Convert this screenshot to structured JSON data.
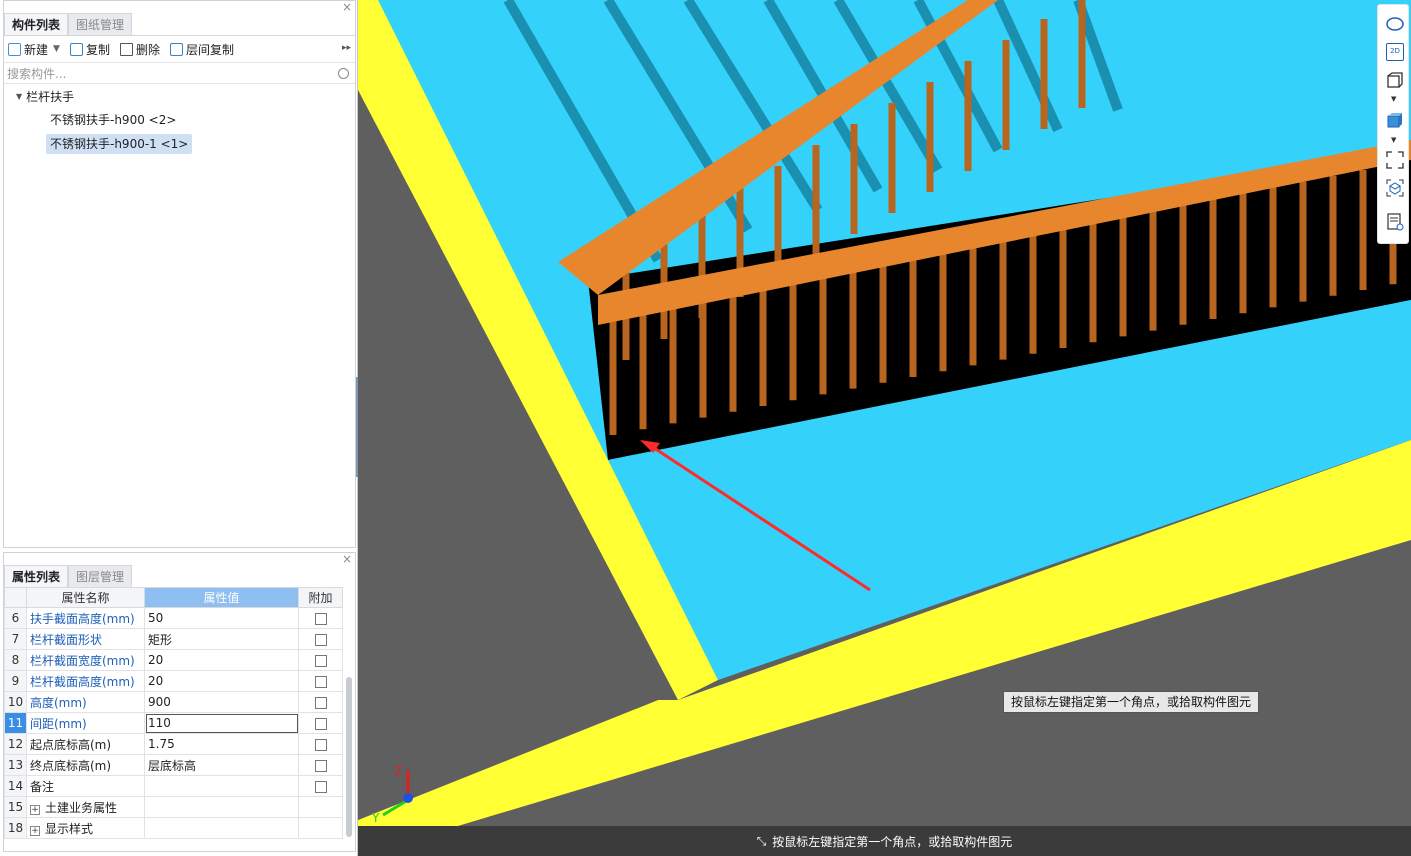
{
  "component_panel": {
    "tabs": [
      "构件列表",
      "图纸管理"
    ],
    "toolbar": {
      "new": "新建",
      "copy": "复制",
      "delete": "删除",
      "floor_copy": "层间复制"
    },
    "search_placeholder": "搜索构件...",
    "tree": {
      "root": "栏杆扶手",
      "items": [
        {
          "label": "不锈钢扶手-h900 <2>",
          "selected": false
        },
        {
          "label": "不锈钢扶手-h900-1 <1>",
          "selected": true
        }
      ]
    }
  },
  "property_panel": {
    "tabs": [
      "属性列表",
      "图层管理"
    ],
    "headers": {
      "name": "属性名称",
      "value": "属性值",
      "extra": "附加"
    },
    "rows": [
      {
        "num": "6",
        "name": "扶手截面高度(mm)",
        "value": "50",
        "blue": true,
        "check": true
      },
      {
        "num": "7",
        "name": "栏杆截面形状",
        "value": "矩形",
        "blue": true,
        "check": true
      },
      {
        "num": "8",
        "name": "栏杆截面宽度(mm)",
        "value": "20",
        "blue": true,
        "check": true
      },
      {
        "num": "9",
        "name": "栏杆截面高度(mm)",
        "value": "20",
        "blue": true,
        "check": true
      },
      {
        "num": "10",
        "name": "高度(mm)",
        "value": "900",
        "blue": true,
        "check": true
      },
      {
        "num": "11",
        "name": "间距(mm)",
        "value": "110",
        "blue": true,
        "check": true,
        "current": true
      },
      {
        "num": "12",
        "name": "起点底标高(m)",
        "value": "1.75",
        "blue": false,
        "check": true
      },
      {
        "num": "13",
        "name": "终点底标高(m)",
        "value": "层底标高",
        "blue": false,
        "check": true
      },
      {
        "num": "14",
        "name": "备注",
        "value": "",
        "blue": false,
        "check": true
      },
      {
        "num": "15",
        "name": "土建业务属性",
        "value": "",
        "blue": false,
        "check": false,
        "group": true
      },
      {
        "num": "18",
        "name": "显示样式",
        "value": "",
        "blue": false,
        "check": false,
        "group": true
      }
    ]
  },
  "viewport": {
    "tooltip": "按鼠标左键指定第一个角点，或拾取构件图元",
    "status": "按鼠标左键指定第一个角点，或拾取构件图元",
    "axis_labels": {
      "z": "Z",
      "y": "Y"
    },
    "view_mode_icon": "2D",
    "colors": {
      "floor": "#34d1fb",
      "beam": "#ffff33",
      "railing": "#e8862e",
      "background": "#5f5f5f"
    }
  }
}
